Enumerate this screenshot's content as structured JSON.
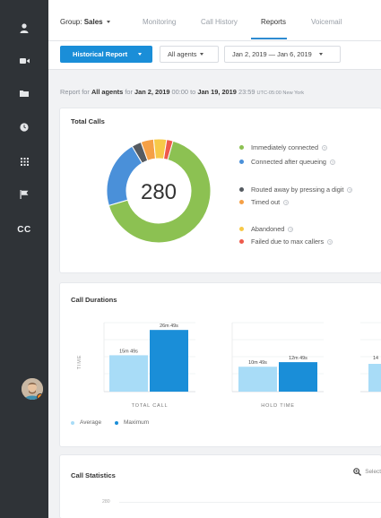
{
  "sidebar": {
    "items": [
      {
        "icon": "user-icon"
      },
      {
        "icon": "video-icon"
      },
      {
        "icon": "folder-icon"
      },
      {
        "icon": "clock-icon"
      },
      {
        "icon": "grid-icon"
      },
      {
        "icon": "flag-icon"
      },
      {
        "icon": "cc-icon",
        "label": "CC"
      }
    ],
    "avatar_status_color": "#ff8a1e"
  },
  "topnav": {
    "group_prefix": "Group:",
    "group_value": "Sales",
    "tabs": [
      "Monitoring",
      "Call History",
      "Reports",
      "Voicemail"
    ],
    "active_tab": "Reports"
  },
  "filters": {
    "report_button": "Historical Report",
    "agents": "All agents",
    "date_range": "Jan 2, 2019 — Jan 6, 2019"
  },
  "report_line": {
    "prefix": "Report for",
    "agents": "All agents",
    "for": "for",
    "start_date": "Jan 2, 2019",
    "start_time": "00:00",
    "to": "to",
    "end_date": "Jan 19, 2019",
    "end_time": "23:59",
    "timezone": "UTC-05:00 New York"
  },
  "total_calls": {
    "title": "Total Calls",
    "total": "280",
    "legend": [
      {
        "label": "Immediately connected",
        "color": "#8cc152"
      },
      {
        "label": "Connected after queueing",
        "color": "#4a90d9"
      },
      {
        "label": "Routed away by pressing a digit",
        "color": "#555b61"
      },
      {
        "label": "Timed out",
        "color": "#f5a046"
      },
      {
        "label": "Abandoned",
        "color": "#f7c948"
      },
      {
        "label": "Failed due to max callers",
        "color": "#ee5a4b"
      }
    ],
    "chart_data": {
      "type": "pie",
      "labels": [
        "Immediately connected",
        "Connected after queueing",
        "Routed away by pressing a digit",
        "Timed out",
        "Abandoned",
        "Failed due to max callers"
      ],
      "values": [
        0.66,
        0.21,
        0.03,
        0.04,
        0.04,
        0.02
      ],
      "colors": [
        "#8cc152",
        "#4a90d9",
        "#555b61",
        "#f5a046",
        "#f7c948",
        "#ee5a4b"
      ],
      "donut": true,
      "center_label": "280"
    }
  },
  "call_durations": {
    "title": "Call Durations",
    "y_axis_label": "TIME",
    "legend": [
      {
        "label": "Average",
        "color": "#a8dcf7"
      },
      {
        "label": "Maximum",
        "color": "#1a8ed8"
      }
    ],
    "chart_data": {
      "type": "bar",
      "categories": [
        "TOTAL CALL",
        "HOLD TIME"
      ],
      "series": [
        {
          "name": "Average",
          "values": [
            949,
            649
          ],
          "labels": [
            "15m 49s",
            "10m 49s"
          ]
        },
        {
          "name": "Maximum",
          "values": [
            1609,
            769
          ],
          "labels": [
            "26m 49s",
            "12m 49s"
          ]
        }
      ],
      "partial_third_bar_label": "14"
    }
  },
  "call_statistics": {
    "title": "Call Statistics",
    "select_label": "Select",
    "y_tick": "280"
  }
}
